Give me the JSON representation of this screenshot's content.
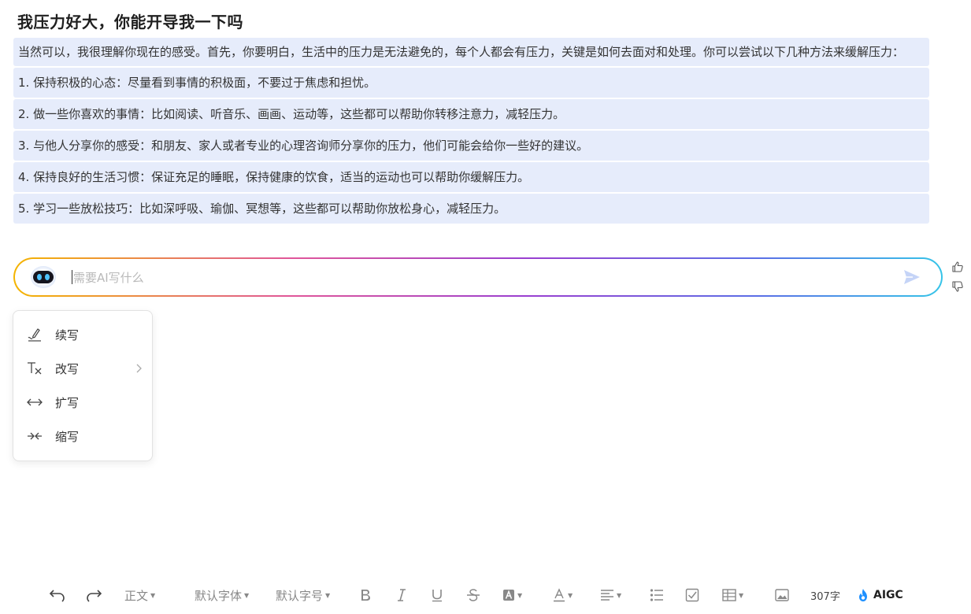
{
  "question": "我压力好大，你能开导我一下吗",
  "answer": {
    "paragraphs": [
      "当然可以，我很理解你现在的感受。首先，你要明白，生活中的压力是无法避免的，每个人都会有压力，关键是如何去面对和处理。你可以尝试以下几种方法来缓解压力：",
      "1. 保持积极的心态：尽量看到事情的积极面，不要过于焦虑和担忧。",
      "2. 做一些你喜欢的事情：比如阅读、听音乐、画画、运动等，这些都可以帮助你转移注意力，减轻压力。",
      "3. 与他人分享你的感受：和朋友、家人或者专业的心理咨询师分享你的压力，他们可能会给你一些好的建议。",
      "4. 保持良好的生活习惯：保证充足的睡眠，保持健康的饮食，适当的运动也可以帮助你缓解压力。",
      "5. 学习一些放松技巧：比如深呼吸、瑜伽、冥想等，这些都可以帮助你放松身心，减轻压力。"
    ]
  },
  "ai_input": {
    "placeholder": "需要AI写什么",
    "value": ""
  },
  "menu": {
    "items": [
      {
        "label": "续写",
        "icon": "pen-icon"
      },
      {
        "label": "改写",
        "icon": "text-clear-icon",
        "has_submenu": true
      },
      {
        "label": "扩写",
        "icon": "expand-arrows-icon"
      },
      {
        "label": "缩写",
        "icon": "shrink-arrows-icon"
      }
    ]
  },
  "toolbar": {
    "paragraph_style": "正文",
    "font_family": "默认字体",
    "font_size": "默认字号",
    "word_count": "307字",
    "aigc_label": "AIGC"
  },
  "colors": {
    "answer_bg": "#e6ecfb",
    "gradient": [
      "#f4b400",
      "#e0569a",
      "#9a3fd0",
      "#5b6ee6",
      "#36c4e8"
    ],
    "send_icon": "#c5d4f7"
  }
}
